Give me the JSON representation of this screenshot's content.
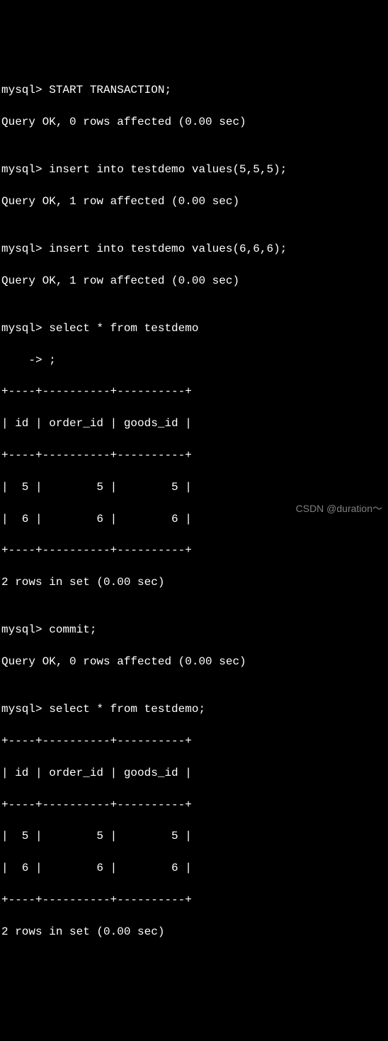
{
  "terminal": {
    "prompt": "mysql>",
    "cont_prompt": "    ->",
    "lines": [
      "mysql> START TRANSACTION;",
      "Query OK, 0 rows affected (0.00 sec)",
      "",
      "mysql> insert into testdemo values(5,5,5);",
      "Query OK, 1 row affected (0.00 sec)",
      "",
      "mysql> insert into testdemo values(6,6,6);",
      "Query OK, 1 row affected (0.00 sec)",
      "",
      "mysql> select * from testdemo",
      "    -> ;",
      "+----+----------+----------+",
      "| id | order_id | goods_id |",
      "+----+----------+----------+",
      "|  5 |        5 |        5 |",
      "|  6 |        6 |        6 |",
      "+----+----------+----------+",
      "2 rows in set (0.00 sec)",
      "",
      "mysql> commit;",
      "Query OK, 0 rows affected (0.00 sec)",
      "",
      "mysql> select * from testdemo;",
      "+----+----------+----------+",
      "| id | order_id | goods_id |",
      "+----+----------+----------+",
      "|  5 |        5 |        5 |",
      "|  6 |        6 |        6 |",
      "+----+----------+----------+",
      "2 rows in set (0.00 sec)"
    ]
  },
  "commands": {
    "start_transaction": "START TRANSACTION;",
    "insert1": "insert into testdemo values(5,5,5);",
    "insert2": "insert into testdemo values(6,6,6);",
    "select1": "select * from testdemo",
    "select1_cont": ";",
    "commit": "commit;",
    "select2": "select * from testdemo;"
  },
  "responses": {
    "ok_0rows": "Query OK, 0 rows affected (0.00 sec)",
    "ok_1row": "Query OK, 1 row affected (0.00 sec)",
    "set_2rows": "2 rows in set (0.00 sec)"
  },
  "table": {
    "columns": [
      "id",
      "order_id",
      "goods_id"
    ],
    "rows": [
      {
        "id": 5,
        "order_id": 5,
        "goods_id": 5
      },
      {
        "id": 6,
        "order_id": 6,
        "goods_id": 6
      }
    ]
  },
  "watermark": "CSDN @duration～"
}
